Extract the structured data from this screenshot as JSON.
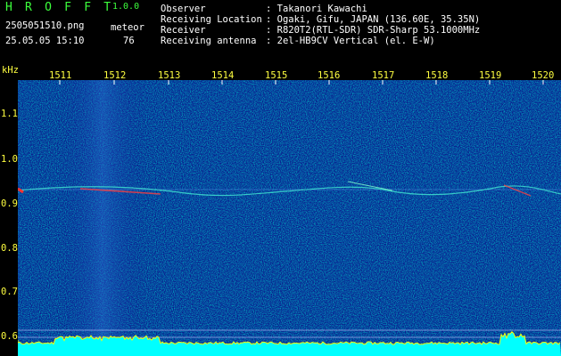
{
  "header": {
    "app_title": "H R O F F T",
    "app_version": "1.0.0",
    "file_name": "2505051510.png",
    "meteor_label": "meteor",
    "date_time": "25.05.05 15:10",
    "meteor_count": "76",
    "info": [
      {
        "label": "Observer",
        "value": ": Takanori Kawachi"
      },
      {
        "label": "Receiving Location",
        "value": ": Ogaki, Gifu, JAPAN (136.60E, 35.35N)"
      },
      {
        "label": "Receiver",
        "value": ": R820T2(RTL-SDR) SDR-Sharp 53.1000MHz"
      },
      {
        "label": "Receiving antenna",
        "value": ": 2el-HB9CV Vertical (el. E-W)"
      }
    ]
  },
  "axis": {
    "y_unit": "kHz",
    "y_ticks": [
      "1.1",
      "1.0",
      "0.9",
      "0.8",
      "0.7",
      "0.6"
    ],
    "x_ticks": [
      "1511",
      "1512",
      "1513",
      "1514",
      "1515",
      "1516",
      "1517",
      "1518",
      "1519",
      "1520"
    ]
  },
  "colors": {
    "background": "#000000",
    "label_green": "#3cff3c",
    "label_yellow": "#ffff40",
    "spectrogram_base": "#0a1a8c",
    "signal_red": "#ff3030",
    "bottom_bar": "#ffff00",
    "bottom_fill": "#00ffff"
  }
}
